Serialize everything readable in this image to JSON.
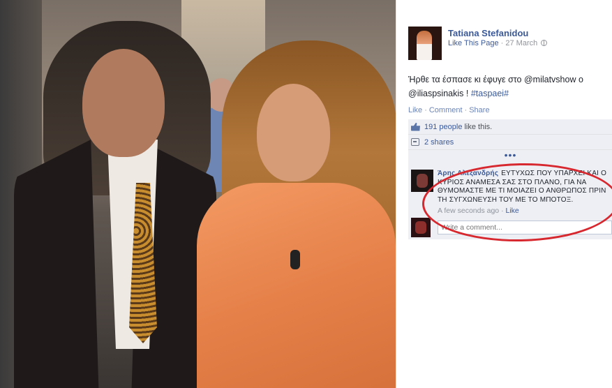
{
  "post": {
    "page_name": "Tatiana Stefanidou",
    "like_this_page": "Like This Page",
    "meta_sep": "·",
    "date": "27 March",
    "text_main": "Ήρθε τα έσπασε κι έφυγε στο @milatvshow ο @iliaspsinakis ! ",
    "text_hashtag": "#taspaei#"
  },
  "actions": {
    "like": "Like",
    "comment": "Comment",
    "share": "Share",
    "sep": "·"
  },
  "ufi": {
    "likes_count_link": "191 people",
    "likes_suffix": "like this.",
    "shares_link": "2 shares",
    "more_dots": "•••"
  },
  "comment": {
    "author": "Άρης Αλεξανδρής",
    "text": "ΕΥΤΥΧΩΣ ΠΟΥ ΥΠΑΡΧΕΙ ΚΑΙ Ο ΚΥΡΙΟΣ ΑΝΑΜΕΣΑ ΣΑΣ ΣΤΟ ΠΛΑΝΟ, ΓΙΑ ΝΑ ΘΥΜΟΜΑΣΤΕ ΜΕ ΤΙ ΜΟΙΑΖΕΙ Ο ΑΝΘΡΩΠΟΣ ΠΡΙΝ ΤΗ ΣΥΓΧΩΝΕΥΣΗ ΤΟΥ ΜΕ ΤΟ ΜΠΟΤΟΞ.",
    "time": "A few seconds ago",
    "sep": "·",
    "like": "Like"
  },
  "composer": {
    "placeholder": "Write a comment..."
  },
  "colors": {
    "link": "#3b5998",
    "annotation": "#d7282f",
    "dress": "#e6814a"
  },
  "icons": [
    "globe-icon",
    "thumb-icon",
    "share-icon"
  ]
}
